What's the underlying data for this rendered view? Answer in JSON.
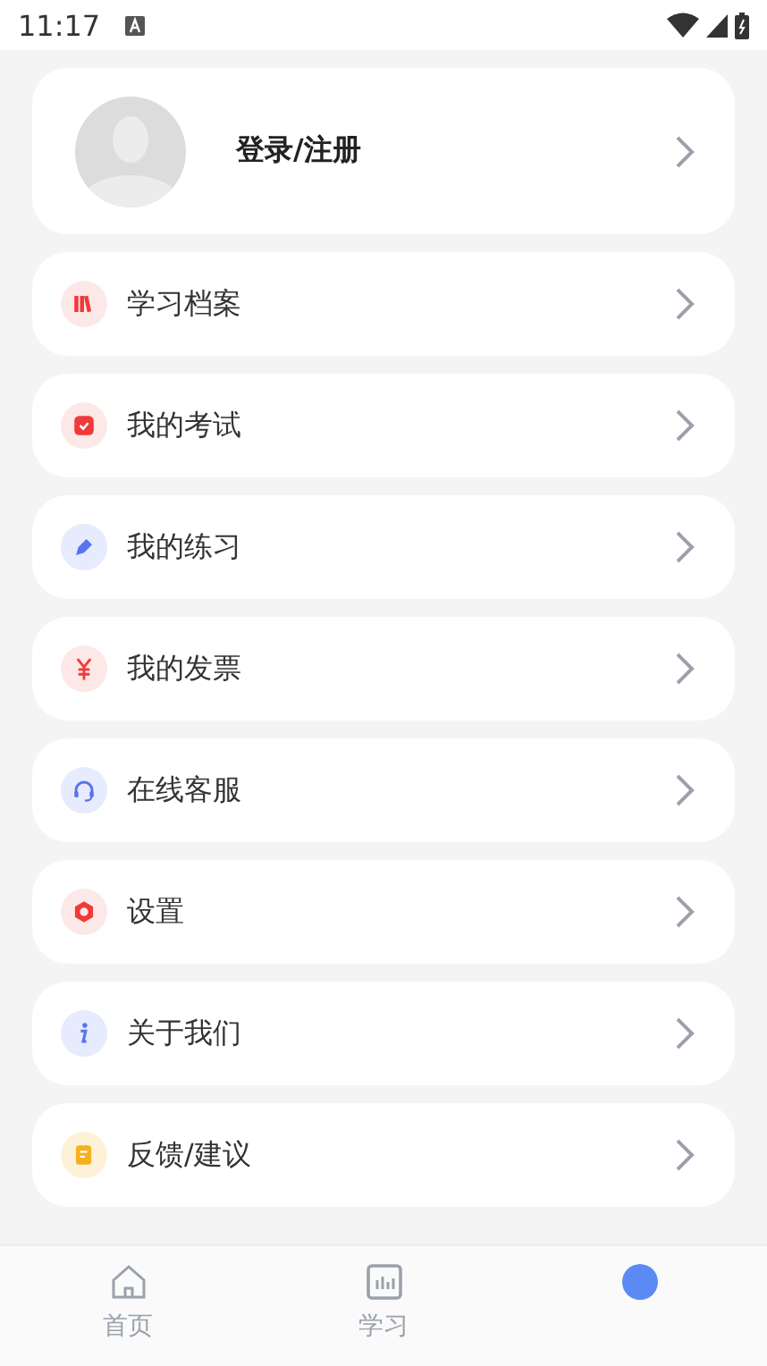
{
  "status_bar": {
    "time": "11:17"
  },
  "profile": {
    "label": "登录/注册"
  },
  "menu": [
    {
      "label": "学习档案",
      "kind": "books"
    },
    {
      "label": "我的考试",
      "kind": "exam"
    },
    {
      "label": "我的练习",
      "kind": "pen"
    },
    {
      "label": "我的发票",
      "kind": "yen"
    },
    {
      "label": "在线客服",
      "kind": "headset"
    },
    {
      "label": "设置",
      "kind": "gear"
    },
    {
      "label": "关于我们",
      "kind": "info"
    },
    {
      "label": "反馈/建议",
      "kind": "note"
    }
  ],
  "tabs": [
    {
      "label": "首页",
      "kind": "home",
      "selected": false
    },
    {
      "label": "学习",
      "kind": "chart",
      "selected": false
    },
    {
      "kind": "me",
      "selected": true
    }
  ]
}
